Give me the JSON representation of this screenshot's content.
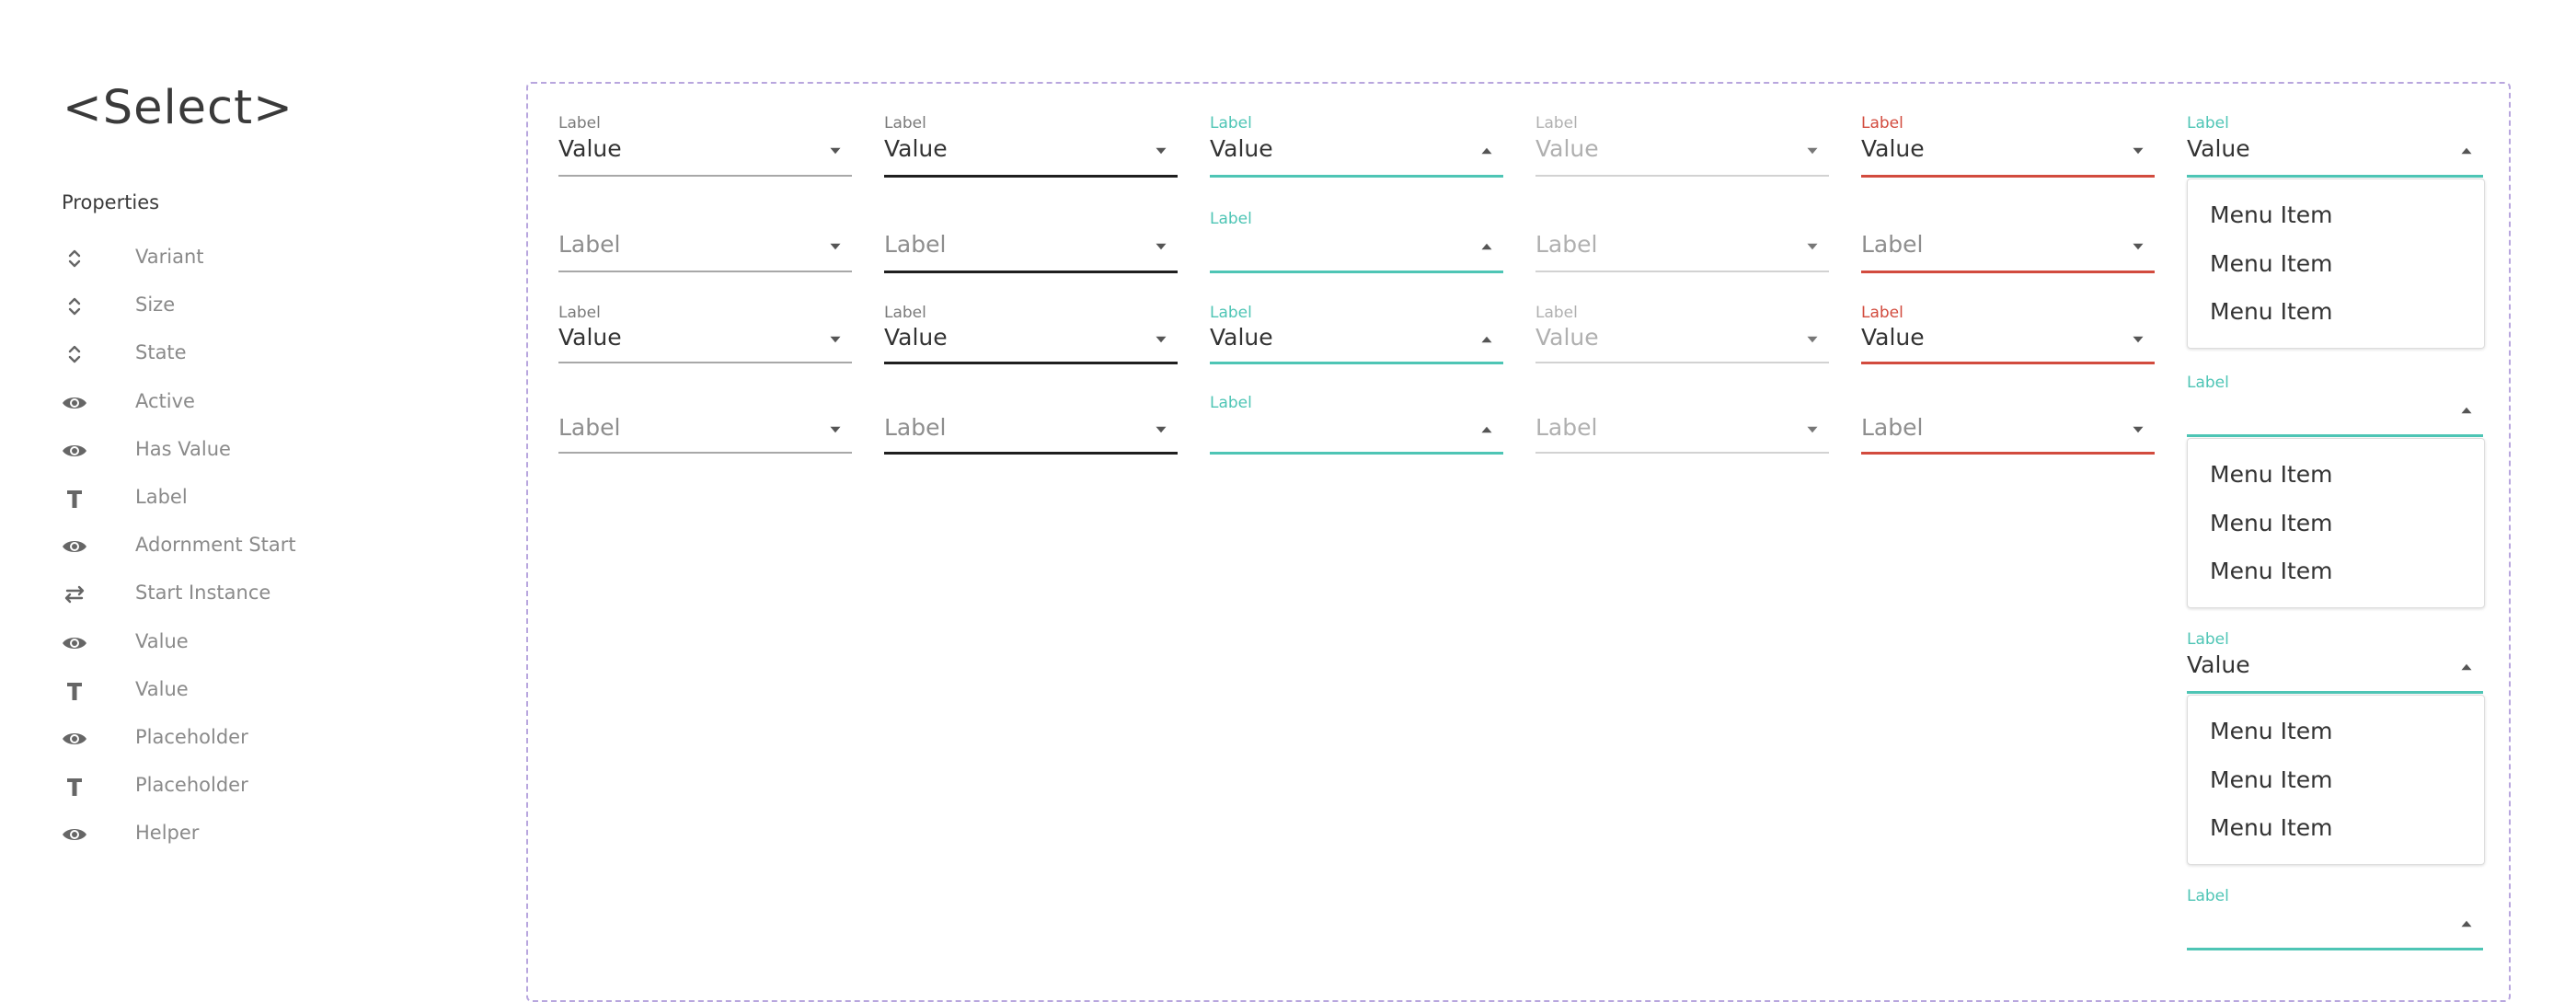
{
  "title": "<Select>",
  "properties_heading": "Properties",
  "properties": [
    {
      "label": "Variant",
      "icon": "unfold-icon"
    },
    {
      "label": "Size",
      "icon": "unfold-icon"
    },
    {
      "label": "State",
      "icon": "unfold-icon"
    },
    {
      "label": "Active",
      "icon": "eye-icon"
    },
    {
      "label": "Has Value",
      "icon": "eye-icon"
    },
    {
      "label": "Label",
      "icon": "text-icon"
    },
    {
      "label": "Adornment Start",
      "icon": "eye-icon"
    },
    {
      "label": "Start Instance",
      "icon": "swap-icon"
    },
    {
      "label": "Value",
      "icon": "eye-icon"
    },
    {
      "label": "Value",
      "icon": "text-icon"
    },
    {
      "label": "Placeholder",
      "icon": "eye-icon"
    },
    {
      "label": "Placeholder",
      "icon": "text-icon"
    },
    {
      "label": "Helper",
      "icon": "eye-icon"
    }
  ],
  "colors": {
    "focused": "#4ec5b5",
    "error": "#d24b3e",
    "default_line": "#a8a8a8",
    "hover_line": "#1f1f1f",
    "disabled_text": "#b0b0b0",
    "label_text": "#7a7a7a",
    "value_text": "#333333",
    "canvas_border": "#b8a6de"
  },
  "label_text": "Label",
  "value_text": "Value",
  "menu_item_text": "Menu Item",
  "grid_columns": [
    {
      "state": "enabled"
    },
    {
      "state": "hovered"
    },
    {
      "state": "focused"
    },
    {
      "state": "disabled"
    },
    {
      "state": "error"
    }
  ],
  "grid_rows": [
    {
      "has_value": true,
      "size": "medium"
    },
    {
      "has_value": false,
      "size": "medium"
    },
    {
      "has_value": true,
      "size": "small"
    },
    {
      "has_value": false,
      "size": "small"
    }
  ],
  "open_selects": [
    {
      "label": "Label",
      "value": "Value",
      "items": [
        "Menu Item",
        "Menu Item",
        "Menu Item"
      ]
    },
    {
      "label": "Label",
      "value": "",
      "items": [
        "Menu Item",
        "Menu Item",
        "Menu Item"
      ]
    },
    {
      "label": "Label",
      "value": "Value",
      "items": [
        "Menu Item",
        "Menu Item",
        "Menu Item"
      ]
    },
    {
      "label": "Label",
      "value": "",
      "items": []
    }
  ]
}
